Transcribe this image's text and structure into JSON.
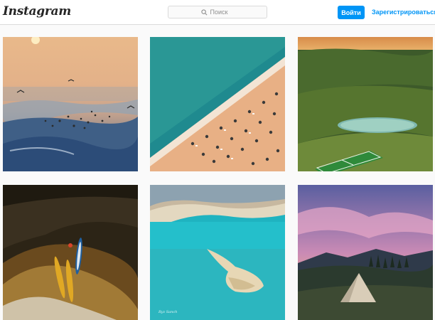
{
  "header": {
    "logo_text": "Instagram",
    "search_placeholder": "Поиск",
    "login_label": "Войти",
    "register_label": "Зарегистрироваться",
    "accent_color": "#0095f6"
  },
  "grid": {
    "posts": [
      {
        "name": "sunset-sea-gulls-post"
      },
      {
        "name": "aerial-beach-umbrellas-post"
      },
      {
        "name": "football-field-lake-post"
      },
      {
        "name": "kayaks-on-rocks-post"
      },
      {
        "name": "turquoise-lake-island-post"
      },
      {
        "name": "tent-mountain-sunset-post"
      }
    ],
    "watermark_text": "Ryz Sanch"
  }
}
